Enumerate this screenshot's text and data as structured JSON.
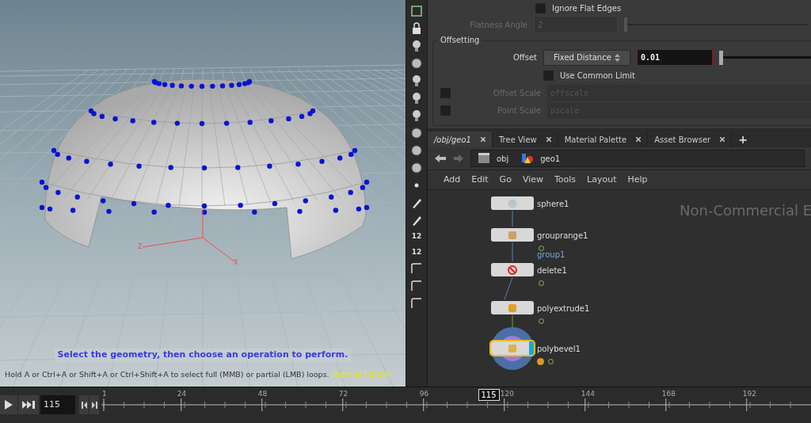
{
  "viewport": {
    "axis_z": "Z",
    "axis_x": "X",
    "instruction": "Select the geometry, then choose an operation to perform.",
    "hint": "Hold A or Ctrl+A or Shift+A or Ctrl+Shift+A to select full (MMB) or partial (LMB) loops.",
    "edition_note": "mercial Edition"
  },
  "shelf": {
    "labels": [
      "12",
      "12"
    ]
  },
  "parameters": {
    "ignore_flat_edges": {
      "label": "Ignore Flat Edges",
      "checked": false
    },
    "flatness_angle": {
      "label": "Flatness Angle",
      "value": "2",
      "disabled": true,
      "level": 0.0
    },
    "offsetting": {
      "title": "Offsetting",
      "offset": {
        "label": "Offset",
        "mode": "Fixed Distance",
        "value": "0.01",
        "level": 0.0
      },
      "use_common_limit": {
        "label": "Use Common Limit",
        "checked": false
      },
      "rows": [
        {
          "label": "Offset Scale",
          "checked": false,
          "placeholder": "offscale"
        },
        {
          "label": "Point Scale",
          "checked": false,
          "placeholder": "pscale"
        }
      ]
    }
  },
  "tabs": [
    {
      "label": "/obj/geo1",
      "selected": true
    },
    {
      "label": "Tree View",
      "selected": false
    },
    {
      "label": "Material Palette",
      "selected": false
    },
    {
      "label": "Asset Browser",
      "selected": false
    }
  ],
  "add_tab": "+",
  "path": [
    "obj",
    "geo1"
  ],
  "menu": [
    "Add",
    "Edit",
    "Go",
    "View",
    "Tools",
    "Layout",
    "Help"
  ],
  "network": {
    "watermark": "Non-Commercial E",
    "nodes": [
      {
        "name": "sphere1",
        "kind": "sphere",
        "selected": false,
        "warning": false,
        "flag": false
      },
      {
        "name": "grouprange1",
        "kind": "group",
        "selected": false,
        "warning": false,
        "flag": true,
        "output_label": "group1"
      },
      {
        "name": "delete1",
        "kind": "delete",
        "selected": false,
        "warning": false,
        "flag": true
      },
      {
        "name": "polyextrude1",
        "kind": "extrude",
        "selected": false,
        "warning": false,
        "flag": true
      },
      {
        "name": "polybevel1",
        "kind": "bevel",
        "selected": true,
        "warning": true,
        "flag": true
      }
    ]
  },
  "timeline": {
    "frame": "115",
    "ticks": [
      "1",
      "24",
      "48",
      "72",
      "96",
      "120",
      "144",
      "168",
      "192"
    ],
    "current": "115"
  }
}
